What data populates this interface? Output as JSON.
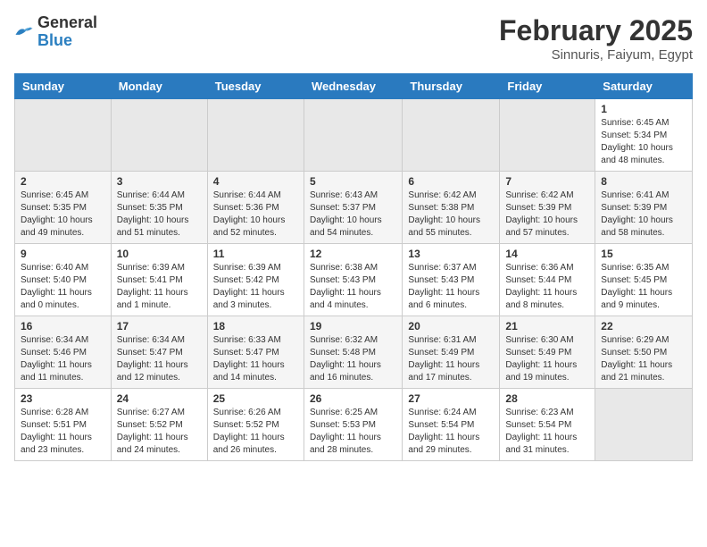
{
  "header": {
    "logo_general": "General",
    "logo_blue": "Blue",
    "month_year": "February 2025",
    "location": "Sinnuris, Faiyum, Egypt"
  },
  "weekdays": [
    "Sunday",
    "Monday",
    "Tuesday",
    "Wednesday",
    "Thursday",
    "Friday",
    "Saturday"
  ],
  "weeks": [
    [
      {
        "day": "",
        "info": ""
      },
      {
        "day": "",
        "info": ""
      },
      {
        "day": "",
        "info": ""
      },
      {
        "day": "",
        "info": ""
      },
      {
        "day": "",
        "info": ""
      },
      {
        "day": "",
        "info": ""
      },
      {
        "day": "1",
        "info": "Sunrise: 6:45 AM\nSunset: 5:34 PM\nDaylight: 10 hours and 48 minutes."
      }
    ],
    [
      {
        "day": "2",
        "info": "Sunrise: 6:45 AM\nSunset: 5:35 PM\nDaylight: 10 hours and 49 minutes."
      },
      {
        "day": "3",
        "info": "Sunrise: 6:44 AM\nSunset: 5:35 PM\nDaylight: 10 hours and 51 minutes."
      },
      {
        "day": "4",
        "info": "Sunrise: 6:44 AM\nSunset: 5:36 PM\nDaylight: 10 hours and 52 minutes."
      },
      {
        "day": "5",
        "info": "Sunrise: 6:43 AM\nSunset: 5:37 PM\nDaylight: 10 hours and 54 minutes."
      },
      {
        "day": "6",
        "info": "Sunrise: 6:42 AM\nSunset: 5:38 PM\nDaylight: 10 hours and 55 minutes."
      },
      {
        "day": "7",
        "info": "Sunrise: 6:42 AM\nSunset: 5:39 PM\nDaylight: 10 hours and 57 minutes."
      },
      {
        "day": "8",
        "info": "Sunrise: 6:41 AM\nSunset: 5:39 PM\nDaylight: 10 hours and 58 minutes."
      }
    ],
    [
      {
        "day": "9",
        "info": "Sunrise: 6:40 AM\nSunset: 5:40 PM\nDaylight: 11 hours and 0 minutes."
      },
      {
        "day": "10",
        "info": "Sunrise: 6:39 AM\nSunset: 5:41 PM\nDaylight: 11 hours and 1 minute."
      },
      {
        "day": "11",
        "info": "Sunrise: 6:39 AM\nSunset: 5:42 PM\nDaylight: 11 hours and 3 minutes."
      },
      {
        "day": "12",
        "info": "Sunrise: 6:38 AM\nSunset: 5:43 PM\nDaylight: 11 hours and 4 minutes."
      },
      {
        "day": "13",
        "info": "Sunrise: 6:37 AM\nSunset: 5:43 PM\nDaylight: 11 hours and 6 minutes."
      },
      {
        "day": "14",
        "info": "Sunrise: 6:36 AM\nSunset: 5:44 PM\nDaylight: 11 hours and 8 minutes."
      },
      {
        "day": "15",
        "info": "Sunrise: 6:35 AM\nSunset: 5:45 PM\nDaylight: 11 hours and 9 minutes."
      }
    ],
    [
      {
        "day": "16",
        "info": "Sunrise: 6:34 AM\nSunset: 5:46 PM\nDaylight: 11 hours and 11 minutes."
      },
      {
        "day": "17",
        "info": "Sunrise: 6:34 AM\nSunset: 5:47 PM\nDaylight: 11 hours and 12 minutes."
      },
      {
        "day": "18",
        "info": "Sunrise: 6:33 AM\nSunset: 5:47 PM\nDaylight: 11 hours and 14 minutes."
      },
      {
        "day": "19",
        "info": "Sunrise: 6:32 AM\nSunset: 5:48 PM\nDaylight: 11 hours and 16 minutes."
      },
      {
        "day": "20",
        "info": "Sunrise: 6:31 AM\nSunset: 5:49 PM\nDaylight: 11 hours and 17 minutes."
      },
      {
        "day": "21",
        "info": "Sunrise: 6:30 AM\nSunset: 5:49 PM\nDaylight: 11 hours and 19 minutes."
      },
      {
        "day": "22",
        "info": "Sunrise: 6:29 AM\nSunset: 5:50 PM\nDaylight: 11 hours and 21 minutes."
      }
    ],
    [
      {
        "day": "23",
        "info": "Sunrise: 6:28 AM\nSunset: 5:51 PM\nDaylight: 11 hours and 23 minutes."
      },
      {
        "day": "24",
        "info": "Sunrise: 6:27 AM\nSunset: 5:52 PM\nDaylight: 11 hours and 24 minutes."
      },
      {
        "day": "25",
        "info": "Sunrise: 6:26 AM\nSunset: 5:52 PM\nDaylight: 11 hours and 26 minutes."
      },
      {
        "day": "26",
        "info": "Sunrise: 6:25 AM\nSunset: 5:53 PM\nDaylight: 11 hours and 28 minutes."
      },
      {
        "day": "27",
        "info": "Sunrise: 6:24 AM\nSunset: 5:54 PM\nDaylight: 11 hours and 29 minutes."
      },
      {
        "day": "28",
        "info": "Sunrise: 6:23 AM\nSunset: 5:54 PM\nDaylight: 11 hours and 31 minutes."
      },
      {
        "day": "",
        "info": ""
      }
    ]
  ]
}
